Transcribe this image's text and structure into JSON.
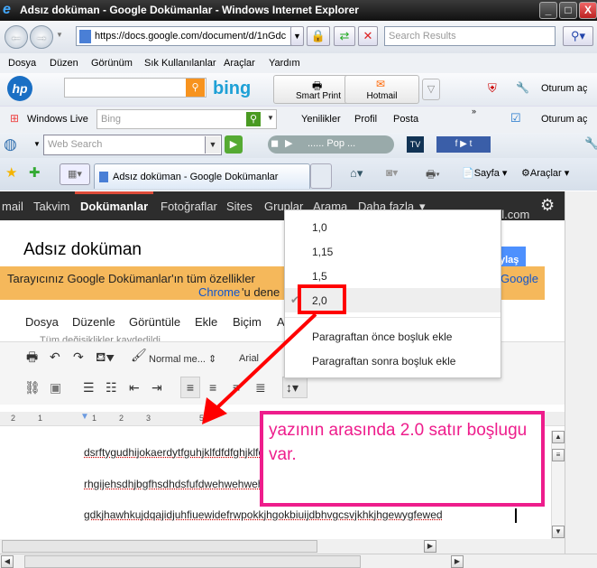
{
  "window": {
    "title": "Adsız doküman - Google Dokümanlar - Windows Internet Explorer"
  },
  "addressbar": {
    "url": "https://docs.google.com/document/d/1nGdc",
    "search_placeholder": "Search Results"
  },
  "ie_menu": [
    "Dosya",
    "Düzen",
    "Görünüm",
    "Sık Kullanılanlar",
    "Araçlar",
    "Yardım"
  ],
  "hp_toolbar": {
    "brand": "bing",
    "smart_print": "Smart Print",
    "hotmail": "Hotmail",
    "signin": "Oturum aç"
  },
  "wl_toolbar": {
    "brand": "Windows Live",
    "search_placeholder": "Bing",
    "links": [
      "Yenilikler",
      "Profil",
      "Posta"
    ],
    "signin": "Oturum aç"
  },
  "ws_toolbar": {
    "search_placeholder": "Web Search",
    "radio": "...... Pop ..."
  },
  "tabs": {
    "active": "Adsız doküman - Google Dokümanlar",
    "page": "Sayfa",
    "tools": "Araçlar"
  },
  "google_bar": {
    "items": [
      "mail",
      "Takvim",
      "Dokümanlar",
      "Fotoğraflar",
      "Sites",
      "Gruplar",
      "Arama",
      "Daha fazla"
    ],
    "account": "mplan76@gmail.com"
  },
  "document": {
    "title": "Adsız doküman",
    "share": "ylaş",
    "saved_status": "Tüm değişiklikler kaydedildi",
    "banner_text": "Tarayıcınız Google Dokümanlar'ın tüm özellikler",
    "banner_link_google": "Google",
    "banner_link_chrome": "Chrome",
    "banner_tail": "'u dene",
    "menu": [
      "Dosya",
      "Düzenle",
      "Görüntüle",
      "Ekle",
      "Biçim",
      "A"
    ],
    "style_select": "Normal me...",
    "font_select": "Arial",
    "ruler": [
      "2",
      "1",
      "1",
      "2",
      "3",
      "5",
      "14"
    ],
    "lines": [
      "dsrftygudhijokaerdytfguhjklfdfdfghjklfdfdfghjklfgfhjkuf",
      "rhgijehsdhjbgfhsdhdsfufdwehwehwehsdhjbgfhsdhdsfufdwehh",
      "gdkjhawhkujdqajidjuhfiuewidefrwpokkjhgokbiuijdbhvgcsvjkhkjhgewygfewed"
    ]
  },
  "line_spacing_menu": {
    "options": [
      "1,0",
      "1,15",
      "1,5",
      "2,0"
    ],
    "selected": "2,0",
    "before": "Paragraftan önce boşluk ekle",
    "after": "Paragraftan sonra boşluk ekle"
  },
  "annotation": {
    "text": "yazının arasında 2.0 satır boşlugu var.",
    "color": "#ee1d8c",
    "highlight_color": "#ff0000"
  }
}
